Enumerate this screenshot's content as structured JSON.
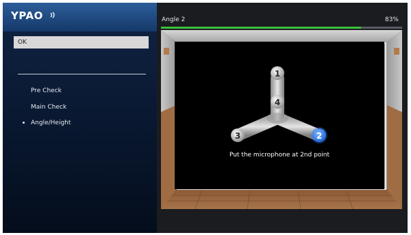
{
  "app": {
    "name": "YPAO"
  },
  "left_panel": {
    "ok_label": "OK",
    "steps": [
      {
        "label": "Pre Check",
        "current": false
      },
      {
        "label": "Main Check",
        "current": false
      },
      {
        "label": "Angle/Height",
        "current": true
      }
    ]
  },
  "measurement": {
    "title": "Angle 2",
    "progress_text": "83%",
    "progress_value": 0.83,
    "instruction": "Put the microphone at 2nd point",
    "points": [
      {
        "number": "1",
        "active": false
      },
      {
        "number": "2",
        "active": true
      },
      {
        "number": "3",
        "active": false
      },
      {
        "number": "4",
        "active": false
      }
    ]
  },
  "colors": {
    "progress": "#3cc23c",
    "active_point": "#2f7cf0",
    "panel_blue": "#15396a"
  },
  "icons": {
    "logo_waves": "sound-waves-icon"
  }
}
